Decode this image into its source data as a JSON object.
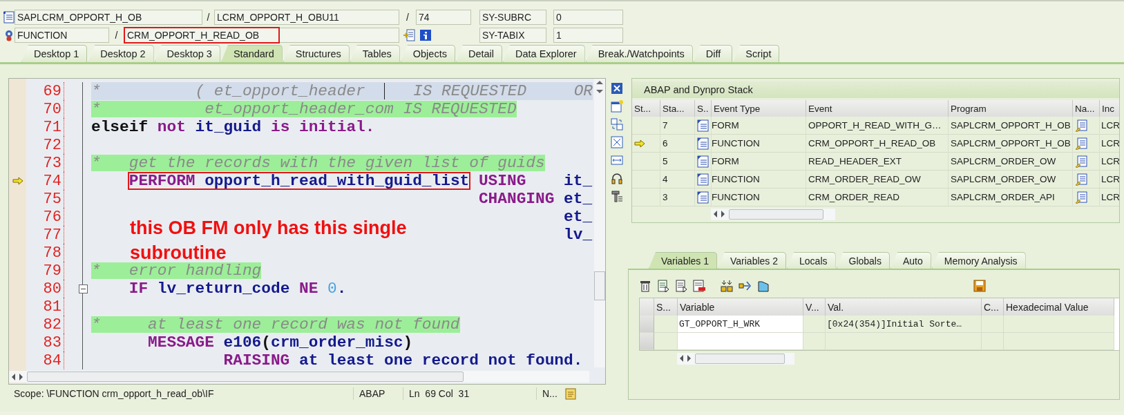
{
  "header": {
    "rows": [
      {
        "kind": "program",
        "fields": [
          {
            "value": "SAPLCRM_OPPORT_H_OB",
            "framed": false
          },
          {
            "separator": "/",
            "value": "LCRM_OPPORT_H_OBU11",
            "framed": false
          },
          {
            "separator": "/",
            "value": "74",
            "framed": false
          }
        ],
        "sys_label": "SY-SUBRC",
        "sys_value": "0"
      },
      {
        "kind": "event",
        "fields": [
          {
            "value": "FUNCTION",
            "framed": false
          },
          {
            "separator": "/",
            "value": "CRM_OPPORT_H_READ_OB",
            "framed": true
          }
        ],
        "sys_label": "SY-TABIX",
        "sys_value": "1"
      }
    ]
  },
  "tabs": [
    {
      "label": "Desktop 1",
      "selected": false
    },
    {
      "label": "Desktop 2",
      "selected": false
    },
    {
      "label": "Desktop 3",
      "selected": false
    },
    {
      "label": "Standard",
      "selected": true
    },
    {
      "label": "Structures",
      "selected": false
    },
    {
      "label": "Tables",
      "selected": false
    },
    {
      "label": "Objects",
      "selected": false
    },
    {
      "label": "Detail",
      "selected": false
    },
    {
      "label": "Data Explorer",
      "selected": false
    },
    {
      "label": "Break./Watchpoints",
      "selected": false
    },
    {
      "label": "Diff",
      "selected": false
    },
    {
      "label": "Script",
      "selected": false
    }
  ],
  "code": {
    "lines": [
      {
        "number": "69",
        "current": true,
        "execution": false,
        "fold": false,
        "tokens": [
          {
            "kind": "comment",
            "text": "*          ( et_opport_header  "
          },
          {
            "kind": "cursor"
          },
          {
            "kind": "comment",
            "text": "   IS REQUESTED     OR"
          }
        ]
      },
      {
        "number": "70",
        "current": false,
        "execution": false,
        "fold": false,
        "tokens": [
          {
            "kind": "comment",
            "text": "*           et_opport_header_com IS REQUESTED"
          }
        ]
      },
      {
        "number": "71",
        "current": false,
        "execution": false,
        "fold": false,
        "tokens": [
          {
            "kind": "plain",
            "text": "elseif "
          },
          {
            "kind": "keyword",
            "text": "not "
          },
          {
            "kind": "ident",
            "text": "it_guid "
          },
          {
            "kind": "keyword",
            "text": "is initial."
          }
        ]
      },
      {
        "number": "72",
        "current": false,
        "execution": false,
        "fold": false
      },
      {
        "number": "73",
        "current": false,
        "execution": false,
        "fold": false,
        "tokens": [
          {
            "kind": "comment",
            "text": "*   get the records with the given list of guids"
          }
        ]
      },
      {
        "number": "74",
        "current": false,
        "execution": true,
        "fold": false,
        "frame": [
          {
            "kind": "keyword",
            "text": "    PERFORM "
          },
          {
            "kind": "ident",
            "text": "opport_h_read_with_guid_list"
          }
        ],
        "tokens": [
          {
            "kind": "keyword",
            "text": " USING"
          },
          {
            "kind": "ident",
            "text": "    it_"
          }
        ]
      },
      {
        "number": "75",
        "current": false,
        "execution": false,
        "fold": false,
        "tokens": [
          {
            "kind": "keyword",
            "text": "                                         CHANGING "
          },
          {
            "kind": "ident",
            "text": "et_"
          }
        ]
      },
      {
        "number": "76",
        "current": false,
        "execution": false,
        "fold": false,
        "tokens": [
          {
            "kind": "ident",
            "text": "                                                  et_"
          }
        ]
      },
      {
        "number": "77",
        "current": false,
        "execution": false,
        "fold": false,
        "tokens": [
          {
            "kind": "ident",
            "text": "                                                  lv_"
          }
        ]
      },
      {
        "number": "78",
        "current": false,
        "execution": false,
        "fold": false
      },
      {
        "number": "79",
        "current": false,
        "execution": false,
        "fold": false,
        "tokens": [
          {
            "kind": "comment",
            "text": "*   error handling"
          }
        ]
      },
      {
        "number": "80",
        "current": false,
        "execution": false,
        "fold": true,
        "tokens": [
          {
            "kind": "keyword",
            "text": "    IF "
          },
          {
            "kind": "ident",
            "text": "lv_return_code "
          },
          {
            "kind": "keyword",
            "text": "NE "
          },
          {
            "kind": "number",
            "text": "0"
          },
          {
            "kind": "ident",
            "text": "."
          }
        ]
      },
      {
        "number": "81",
        "current": false,
        "execution": false,
        "fold": false
      },
      {
        "number": "82",
        "current": false,
        "execution": false,
        "fold": false,
        "tokens": [
          {
            "kind": "comment",
            "text": "*     at least one record was not found"
          }
        ]
      },
      {
        "number": "83",
        "current": false,
        "execution": false,
        "fold": false,
        "tokens": [
          {
            "kind": "keyword",
            "text": "      MESSAGE "
          },
          {
            "kind": "ident",
            "text": "e106"
          },
          {
            "kind": "plain",
            "text": "("
          },
          {
            "kind": "ident",
            "text": "crm_order_misc"
          },
          {
            "kind": "plain",
            "text": ")"
          }
        ]
      },
      {
        "number": "84",
        "current": false,
        "execution": false,
        "fold": false,
        "tokens": [
          {
            "kind": "keyword",
            "text": "              RAISING "
          },
          {
            "kind": "ident",
            "text": "at least one record not found."
          }
        ]
      }
    ],
    "annotation": "this OB FM only has this single subroutine"
  },
  "status_bar": {
    "scope": "Scope: \\FUNCTION crm_opport_h_read_ob\\IF",
    "language": "ABAP",
    "position": "Ln  69 Col  31",
    "mode": "N..."
  },
  "stack": {
    "title": "ABAP and Dynpro Stack",
    "columns": [
      "St...",
      "Sta...",
      "S..",
      "Event Type",
      "Event",
      "Program",
      "Na...",
      "Inc"
    ],
    "rows": [
      {
        "current": false,
        "stack_no": "7",
        "event_type": "FORM",
        "event": "OPPORT_H_READ_WITH_G…",
        "program": "SAPLCRM_OPPORT_H_OB",
        "include": "LCR"
      },
      {
        "current": true,
        "stack_no": "6",
        "event_type": "FUNCTION",
        "event": "CRM_OPPORT_H_READ_OB",
        "program": "SAPLCRM_OPPORT_H_OB",
        "include": "LCR"
      },
      {
        "current": false,
        "stack_no": "5",
        "event_type": "FORM",
        "event": "READ_HEADER_EXT",
        "program": "SAPLCRM_ORDER_OW",
        "include": "LCR"
      },
      {
        "current": false,
        "stack_no": "4",
        "event_type": "FUNCTION",
        "event": "CRM_ORDER_READ_OW",
        "program": "SAPLCRM_ORDER_OW",
        "include": "LCR"
      },
      {
        "current": false,
        "stack_no": "3",
        "event_type": "FUNCTION",
        "event": "CRM_ORDER_READ",
        "program": "SAPLCRM_ORDER_API",
        "include": "LCR"
      }
    ]
  },
  "variables": {
    "tabs": [
      {
        "label": "Variables 1",
        "selected": true
      },
      {
        "label": "Variables 2",
        "selected": false
      },
      {
        "label": "Locals",
        "selected": false
      },
      {
        "label": "Globals",
        "selected": false
      },
      {
        "label": "Auto",
        "selected": false
      },
      {
        "label": "Memory Analysis",
        "selected": false
      }
    ],
    "columns": [
      "S...",
      "Variable",
      "V...",
      "Val.",
      "C...",
      "Hexadecimal Value"
    ],
    "rows": [
      {
        "variable": "GT_OPPORT_H_WRK",
        "value": "[0x24(354)]Initial Sorte…"
      }
    ]
  }
}
